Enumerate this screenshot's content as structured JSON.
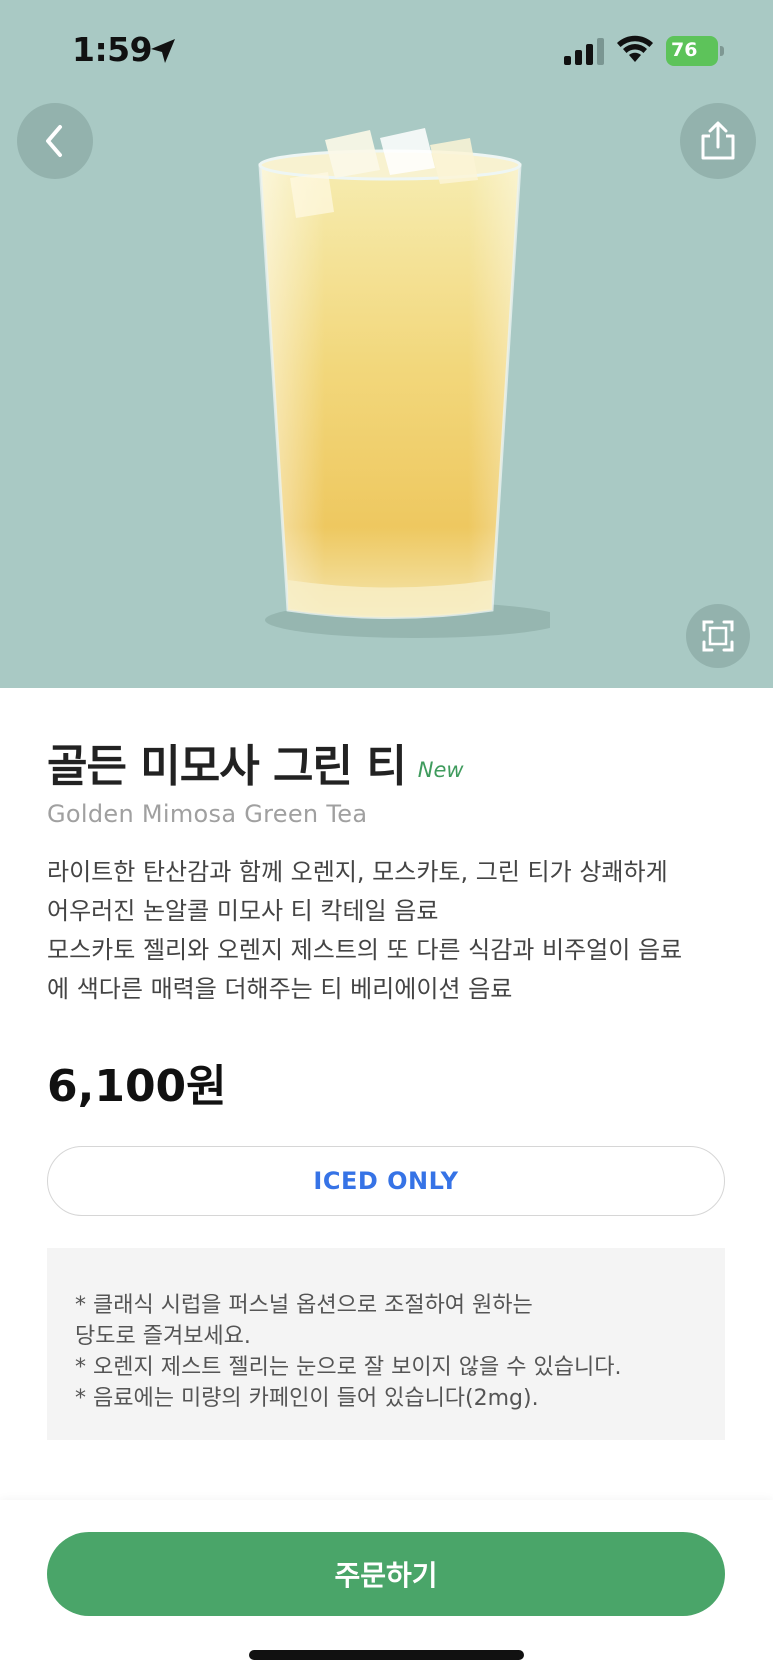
{
  "status_bar": {
    "time": "1:59",
    "battery": "76"
  },
  "hero": {
    "background_color": "#a9c9c4",
    "image_icon": "iced-drink-image",
    "back_icon": "chevron-left-icon",
    "share_icon": "share-icon",
    "expand_icon": "expand-icon"
  },
  "product": {
    "title": "골든 미모사 그린 티",
    "badge": "New",
    "subtitle": "Golden Mimosa Green Tea",
    "description_lines": [
      "라이트한 탄산감과 함께 오렌지, 모스카토, 그린 티가 상쾌하게",
      "어우러진 논알콜 미모사 티 칵테일 음료",
      "모스카토 젤리와 오렌지 제스트의 또 다른 식감과 비주얼이 음료",
      "에 색다른 매력을 더해주는 티 베리에이션 음료"
    ],
    "price": "6,100원",
    "temperature_option": "ICED ONLY"
  },
  "notice": {
    "lines": [
      "* 클래식 시럽을 퍼스널 옵션으로 조절하여 원하는",
      "당도로 즐겨보세요.",
      "* 오렌지 제스트 젤리는 눈으로 잘 보이지 않을 수 있습니다.",
      "* 음료에는 미량의 카페인이 들어 있습니다(2mg)."
    ]
  },
  "bottom": {
    "order_label": "주문하기",
    "accent_color": "#4aa569"
  }
}
